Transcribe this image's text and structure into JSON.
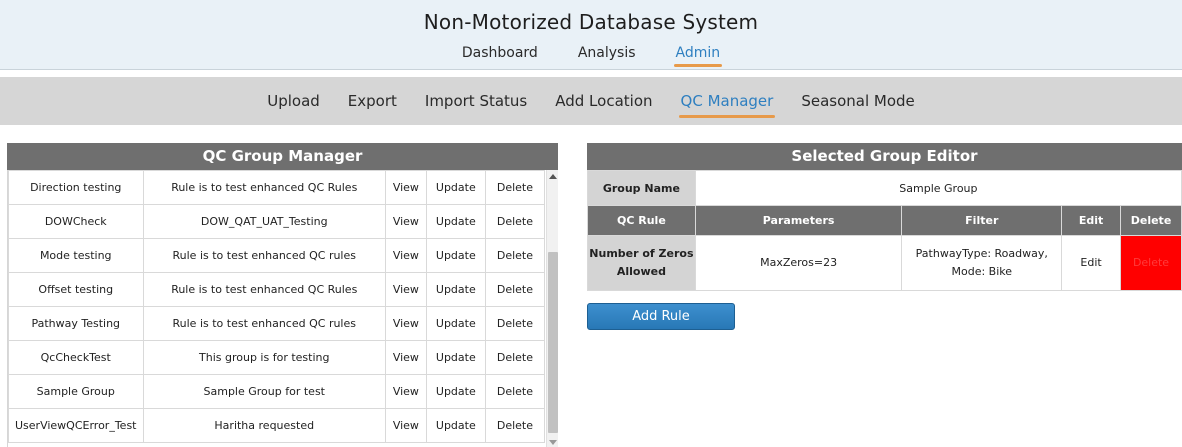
{
  "header": {
    "title": "Non-Motorized Database System",
    "nav": [
      "Dashboard",
      "Analysis",
      "Admin"
    ],
    "active_nav": "Admin"
  },
  "subnav": {
    "items": [
      "Upload",
      "Export",
      "Import Status",
      "Add Location",
      "QC Manager",
      "Seasonal Mode"
    ],
    "active": "QC Manager"
  },
  "group_manager": {
    "title": "QC Group Manager",
    "rows": [
      {
        "name": "Direction testing",
        "description": "Rule is to test enhanced QC Rules",
        "view": "View",
        "update": "Update",
        "delete": "Delete"
      },
      {
        "name": "DOWCheck",
        "description": "DOW_QAT_UAT_Testing",
        "view": "View",
        "update": "Update",
        "delete": "Delete"
      },
      {
        "name": "Mode testing",
        "description": "Rule is to test enhanced QC rules",
        "view": "View",
        "update": "Update",
        "delete": "Delete"
      },
      {
        "name": "Offset testing",
        "description": "Rule is to test enhanced QC Rules",
        "view": "View",
        "update": "Update",
        "delete": "Delete"
      },
      {
        "name": "Pathway Testing",
        "description": "Rule is to test enhanced QC rules",
        "view": "View",
        "update": "Update",
        "delete": "Delete"
      },
      {
        "name": "QcCheckTest",
        "description": "This group is for testing",
        "view": "View",
        "update": "Update",
        "delete": "Delete"
      },
      {
        "name": "Sample Group",
        "description": "Sample Group for test",
        "view": "View",
        "update": "Update",
        "delete": "Delete"
      },
      {
        "name": "UserViewQCError_Test",
        "description": "Haritha requested",
        "view": "View",
        "update": "Update",
        "delete": "Delete"
      }
    ]
  },
  "group_editor": {
    "title": "Selected Group Editor",
    "group_name_label": "Group Name",
    "group_name_value": "Sample Group",
    "columns": [
      "QC Rule",
      "Parameters",
      "Filter",
      "Edit",
      "Delete"
    ],
    "rule": {
      "name_line1": "Number of Zeros",
      "name_line2": "Allowed",
      "parameters": "MaxZeros=23",
      "filter_line1": "PathwayType: Roadway,",
      "filter_line2": "Mode: Bike",
      "edit": "Edit",
      "delete": "Delete"
    },
    "add_rule_label": "Add Rule"
  },
  "colors": {
    "accent": "#2e7fc0",
    "underline": "#e79a4a",
    "panel_header": "#6f6f6f",
    "delete_bg": "#ff0000"
  }
}
